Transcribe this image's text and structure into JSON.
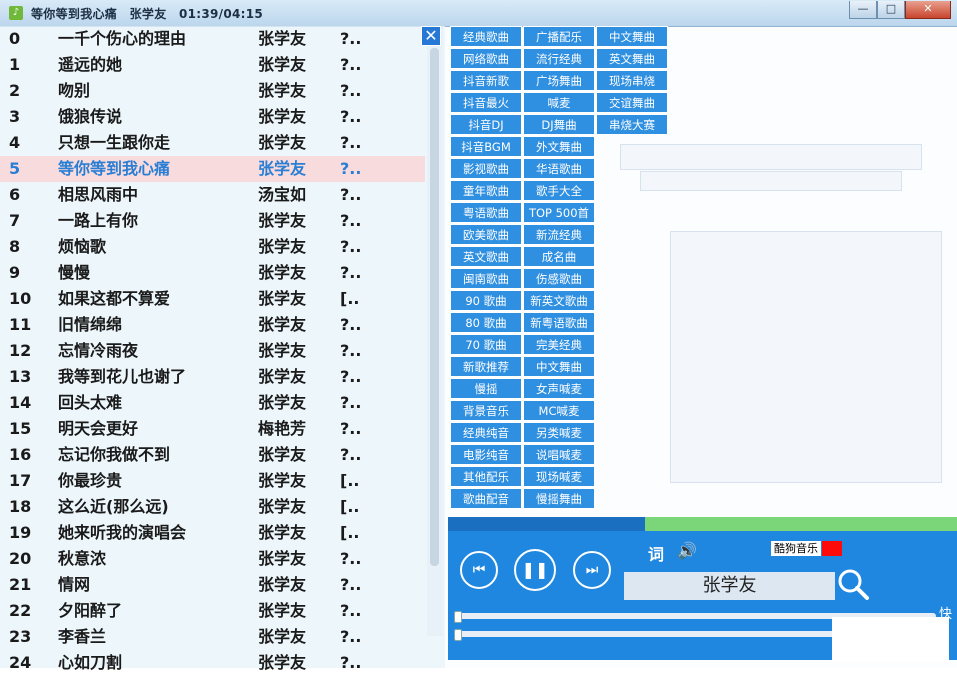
{
  "titlebar": {
    "app_icon": "music-note-icon",
    "title": "等你等到我心痛",
    "artist": "张学友",
    "time": "01:39/04:15",
    "minimize": "—",
    "maximize": "□",
    "close": "✕"
  },
  "playlist": {
    "close_label": "✕",
    "active_index": 5,
    "rows": [
      {
        "num": "0",
        "song": "一千个伤心的理由",
        "artist": "张学友",
        "dur": "?.."
      },
      {
        "num": "1",
        "song": "遥远的她",
        "artist": "张学友",
        "dur": "?.."
      },
      {
        "num": "2",
        "song": "吻别",
        "artist": "张学友",
        "dur": "?.."
      },
      {
        "num": "3",
        "song": "饿狼传说",
        "artist": "张学友",
        "dur": "?.."
      },
      {
        "num": "4",
        "song": "只想一生跟你走",
        "artist": "张学友",
        "dur": "?.."
      },
      {
        "num": "5",
        "song": "等你等到我心痛",
        "artist": "张学友",
        "dur": "?.."
      },
      {
        "num": "6",
        "song": "相思风雨中",
        "artist": "汤宝如",
        "dur": "?.."
      },
      {
        "num": "7",
        "song": "一路上有你",
        "artist": "张学友",
        "dur": "?.."
      },
      {
        "num": "8",
        "song": "烦恼歌",
        "artist": "张学友",
        "dur": "?.."
      },
      {
        "num": "9",
        "song": "慢慢",
        "artist": "张学友",
        "dur": "?.."
      },
      {
        "num": "10",
        "song": "如果这都不算爱",
        "artist": "张学友",
        "dur": "[.."
      },
      {
        "num": "11",
        "song": "旧情绵绵",
        "artist": "张学友",
        "dur": "?.."
      },
      {
        "num": "12",
        "song": "忘情冷雨夜",
        "artist": "张学友",
        "dur": "?.."
      },
      {
        "num": "13",
        "song": "我等到花儿也谢了",
        "artist": "张学友",
        "dur": "?.."
      },
      {
        "num": "14",
        "song": "回头太难",
        "artist": "张学友",
        "dur": "?.."
      },
      {
        "num": "15",
        "song": "明天会更好",
        "artist": "梅艳芳",
        "dur": "?.."
      },
      {
        "num": "16",
        "song": "忘记你我做不到",
        "artist": "张学友",
        "dur": "?.."
      },
      {
        "num": "17",
        "song": "你最珍贵",
        "artist": "张学友",
        "dur": "[.."
      },
      {
        "num": "18",
        "song": "这么近(那么远)",
        "artist": "张学友",
        "dur": "[.."
      },
      {
        "num": "19",
        "song": "她来听我的演唱会",
        "artist": "张学友",
        "dur": "[.."
      },
      {
        "num": "20",
        "song": "秋意浓",
        "artist": "张学友",
        "dur": "?.."
      },
      {
        "num": "21",
        "song": "情网",
        "artist": "张学友",
        "dur": "?.."
      },
      {
        "num": "22",
        "song": "夕阳醉了",
        "artist": "张学友",
        "dur": "?.."
      },
      {
        "num": "23",
        "song": "李香兰",
        "artist": "张学友",
        "dur": "?.."
      },
      {
        "num": "24",
        "song": "心如刀割",
        "artist": "张学友",
        "dur": "?.."
      }
    ]
  },
  "categories": {
    "col1": [
      "经典歌曲",
      "网络歌曲",
      "抖音新歌",
      "抖音最火",
      "抖音DJ",
      "抖音BGM",
      "影视歌曲",
      "童年歌曲",
      "粤语歌曲",
      "欧美歌曲",
      "英文歌曲",
      "闽南歌曲",
      "90 歌曲",
      "80 歌曲",
      "70 歌曲",
      "新歌推荐",
      "慢摇",
      "背景音乐",
      "经典纯音",
      "电影纯音",
      "其他配乐",
      "歌曲配音"
    ],
    "col2": [
      "广播配乐",
      "流行经典",
      "广场舞曲",
      "喊麦",
      "DJ舞曲",
      "外文舞曲",
      "华语歌曲",
      "歌手大全",
      "TOP 500首",
      "新流经典",
      "成名曲",
      "伤感歌曲",
      "新英文歌曲",
      "新粤语歌曲",
      "完美经典",
      "中文舞曲",
      "女声喊麦",
      "MC喊麦",
      "另类喊麦",
      "说唱喊麦",
      "现场喊麦",
      "慢摇舞曲"
    ],
    "col3": [
      "中文舞曲",
      "英文舞曲",
      "现场串烧",
      "交谊舞曲",
      "串烧大赛"
    ]
  },
  "player": {
    "prev_icon": "previous-track-icon",
    "pause_icon": "pause-icon",
    "next_icon": "next-track-icon",
    "lyric_label": "词",
    "volume_icon": "speaker-icon",
    "source_label": "酷狗音乐",
    "search_value": "张学友",
    "search_icon": "magnifier-icon",
    "side_label": "快",
    "colors": {
      "panel": "#1f87e0",
      "accent_green": "#7bd67a",
      "active_row": "#fad6d6",
      "active_text": "#2a7fd4"
    }
  }
}
